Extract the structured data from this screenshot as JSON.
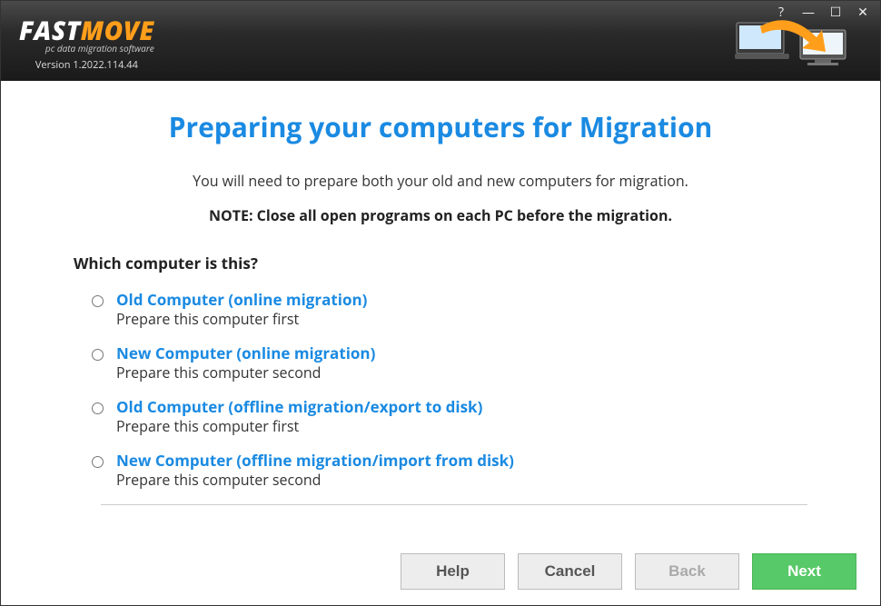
{
  "header": {
    "logo_fast": "FAST",
    "logo_move": "MOVE",
    "tagline": "pc data migration software",
    "version": "Version 1.2022.114.44"
  },
  "window": {
    "help": "?",
    "min": "—",
    "max": "☐",
    "close": "✕"
  },
  "page": {
    "title": "Preparing your computers for Migration",
    "intro": "You will need to prepare both your old and new computers for migration.",
    "note": "NOTE: Close all open programs on each PC before the migration.",
    "question": "Which computer is this?"
  },
  "options": [
    {
      "title": "Old Computer (online migration)",
      "desc": "Prepare this computer first"
    },
    {
      "title": "New Computer (online migration)",
      "desc": "Prepare this computer second"
    },
    {
      "title": "Old Computer (offline migration/export to disk)",
      "desc": "Prepare this computer first"
    },
    {
      "title": "New Computer (offline migration/import from disk)",
      "desc": "Prepare this computer second"
    }
  ],
  "footer": {
    "help": "Help",
    "cancel": "Cancel",
    "back": "Back",
    "next": "Next"
  },
  "colors": {
    "accent": "#1a8ae2",
    "primary_btn": "#58c968",
    "logo_orange": "#ff9e1a"
  }
}
